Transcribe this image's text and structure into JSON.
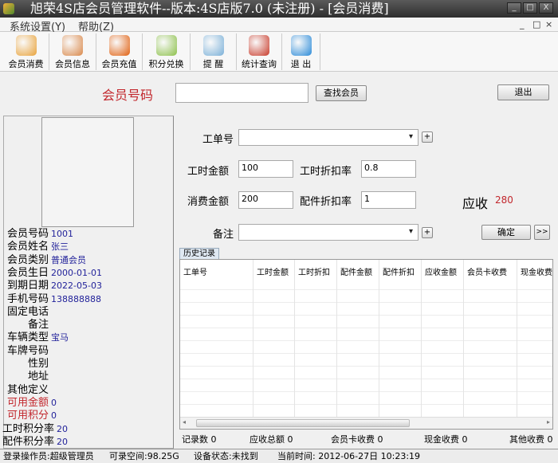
{
  "window": {
    "title": "旭荣4S店会员管理软件--版本:4S店版7.0 (未注册) - [会员消费]",
    "buttons": [
      "_",
      "□",
      "X"
    ]
  },
  "menu": [
    "系统设置(Y)",
    "帮助(Z)"
  ],
  "mdi_controls": [
    "_",
    "□",
    "×"
  ],
  "toolbar": [
    {
      "label": "会员消费",
      "icon": "member-consume-icon",
      "color": "#e8a23a"
    },
    {
      "label": "会员信息",
      "icon": "member-info-icon",
      "color": "#d9884a"
    },
    {
      "label": "会员充值",
      "icon": "recharge-icon",
      "color": "#e06010"
    },
    {
      "label": "积分兑换",
      "icon": "points-exchange-icon",
      "color": "#8cc04a"
    },
    {
      "label": "提 醒",
      "icon": "reminder-icon",
      "color": "#7ab0d8"
    },
    {
      "label": "统计查询",
      "icon": "statistics-icon",
      "color": "#c83a2a"
    },
    {
      "label": "退 出",
      "icon": "exit-icon",
      "color": "#2a8ad8"
    }
  ],
  "search": {
    "label": "会员号码",
    "value": "",
    "find_button": "查找会员",
    "exit_button": "退出"
  },
  "member": {
    "fields": [
      {
        "label": "会员号码",
        "value": "1001"
      },
      {
        "label": "会员姓名",
        "value": "张三"
      },
      {
        "label": "会员类别",
        "value": "普通会员"
      },
      {
        "label": "会员生日",
        "value": "2000-01-01"
      },
      {
        "label": "到期日期",
        "value": "2022-05-03"
      },
      {
        "label": "手机号码",
        "value": "138888888"
      },
      {
        "label": "固定电话",
        "value": ""
      },
      {
        "label": "备注",
        "value": ""
      },
      {
        "label": "车辆类型",
        "value": "宝马"
      },
      {
        "label": "车牌号码",
        "value": ""
      },
      {
        "label": "性别",
        "value": ""
      },
      {
        "label": "地址",
        "value": ""
      },
      {
        "label": "其他定义",
        "value": ""
      },
      {
        "label": "可用金额",
        "value": "0"
      },
      {
        "label": "可用积分",
        "value": "0"
      },
      {
        "label": "工时积分率",
        "value": "20"
      },
      {
        "label": "配件积分率",
        "value": "20"
      }
    ]
  },
  "form": {
    "order_no_label": "工单号",
    "order_no": "",
    "labor_amount_label": "工时金额",
    "labor_amount": "100",
    "labor_discount_label": "工时折扣率",
    "labor_discount": "0.8",
    "consume_amount_label": "消费金额",
    "consume_amount": "200",
    "parts_discount_label": "配件折扣率",
    "parts_discount": "1",
    "receivable_label": "应收",
    "receivable": "280",
    "remark_label": "备注",
    "remark": "",
    "plus": "+",
    "confirm": "确定",
    "more": ">>"
  },
  "history": {
    "tab": "历史记录",
    "columns": [
      "工单号",
      "工时金额",
      "工时折扣",
      "配件金额",
      "配件折扣",
      "应收金额",
      "会员卡收费",
      "现金收费"
    ],
    "rows": [],
    "summary": [
      {
        "label": "记录数",
        "value": "0"
      },
      {
        "label": "应收总额",
        "value": "0"
      },
      {
        "label": "会员卡收费",
        "value": "0"
      },
      {
        "label": "现金收费",
        "value": "0"
      },
      {
        "label": "其他收费",
        "value": "0"
      }
    ]
  },
  "status": {
    "operator": "登录操作员:超级管理员",
    "space": "可录空间:98.25G",
    "device": "设备状态:未找到",
    "time": "当前时间: 2012-06-27日 10:23:19"
  }
}
